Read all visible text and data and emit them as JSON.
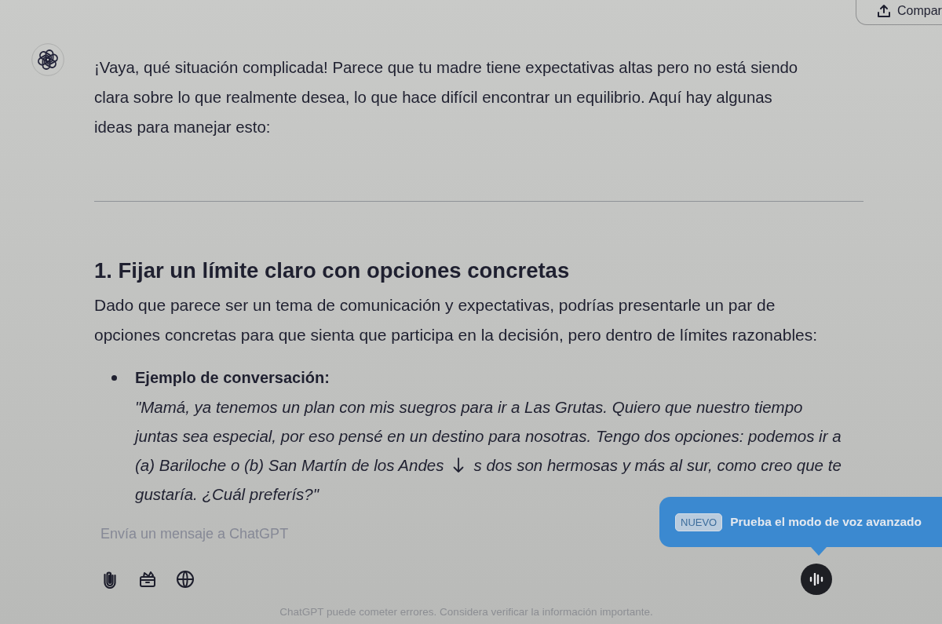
{
  "header": {
    "share_button": {
      "label": "Compar"
    }
  },
  "assistant_message": {
    "intro": "¡Vaya, qué situación complicada! Parece que tu madre tiene expectativas altas pero no está siendo clara sobre lo que realmente desea, lo que hace difícil encontrar un equilibrio. Aquí hay algunas ideas para manejar esto:",
    "sections": [
      {
        "heading": "1. Fijar un límite claro con opciones concretas",
        "body": "Dado que parece ser un tema de comunicación y expectativas, podrías presentarle un par de opciones concretas para que sienta que participa en la decisión, pero dentro de límites razonables:",
        "bullets": [
          {
            "label": "Ejemplo de conversación:",
            "quote_lines": [
              [
                "\"Mamá, ya tenemos un plan con mis suegros para ir a Las Grutas. Quiero que nuestro tiempo"
              ],
              [
                "juntas sea especial, por eso pensé en un destino para nosotras. Tengo dos opciones: podemos ir a"
              ],
              [
                "(a) Bariloche o (b) San Martín de los Andes",
                "s dos son hermosas y más al sur, como creo que te"
              ],
              [
                "gustaría. ¿Cuál preferís?\""
              ]
            ]
          }
        ]
      }
    ]
  },
  "composer": {
    "placeholder": "Envía un mensaje a ChatGPT"
  },
  "voice_tooltip": {
    "badge": "NUEVO",
    "text": "Prueba el modo de voz avanzado"
  },
  "footer": "ChatGPT puede cometer errores. Considera verificar la información importante."
}
